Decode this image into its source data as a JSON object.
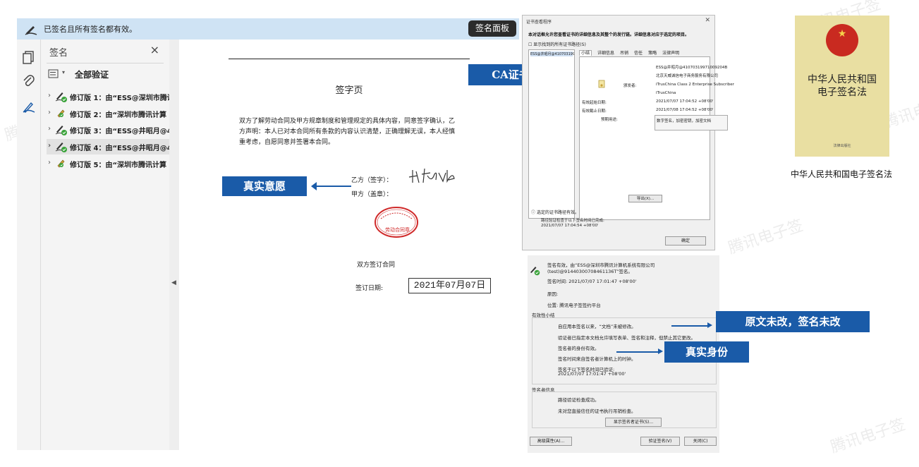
{
  "watermark": "腾讯电子签",
  "sig_bar": {
    "message": "已签名且所有签名都有效。",
    "panel_button": "签名面板"
  },
  "sig_panel": {
    "title": "签名",
    "close": "×",
    "verify_all": "全部验证",
    "revisions": [
      {
        "label": "修订版 1：由“ESS@深圳市腾讯",
        "icon": "valid-signature-icon"
      },
      {
        "label": "修订版 2：由“深圳市腾讯计算",
        "icon": "stamp-signature-icon"
      },
      {
        "label": "修订版 3：由“ESS@井昭月@4",
        "icon": "valid-signature-icon"
      },
      {
        "label": "修订版 4：由“ESS@井昭月@4",
        "icon": "valid-signature-icon",
        "selected": true
      },
      {
        "label": "修订版 5：由“深圳市腾讯计算",
        "icon": "stamp-signature-icon"
      }
    ]
  },
  "document": {
    "title": "签字页",
    "paragraph": "双方了解劳动合同及甲方规章制度和管理规定的具体内容，同意签字确认，乙方声明：本人已对本合同所有条款的内容认识清楚，正确理解无误，本人经慎重考虑，自愿同意并签署本合同。",
    "party_b": "乙方（签字）：",
    "party_a": "甲方（盖章）：",
    "seal_text": "劳动合同章",
    "signed_by_both": "双方签订合同",
    "sign_date_label": "签订日期:",
    "sign_date": "2021年07月07日"
  },
  "callouts": {
    "intent": "真实意愿",
    "ca_cert": "CA证书",
    "unchanged": "原文未改，签名未改",
    "identity": "真实身份"
  },
  "cert_viewer": {
    "title": "证书查看程序",
    "description": "本对话框允许您查看证书的详细信息及其整个的发行链。详细信息对应于选定的项目。",
    "show_all_paths": "显示找到的所有证书路径(S)",
    "list_item": "ESS@井昭月@41070319971002...",
    "tabs": [
      "小结",
      "详细信息",
      "吊销",
      "信任",
      "策略",
      "法律声明"
    ],
    "subject_lines": [
      "ESS@井昭月@41070319971009204B",
      "北京天威诚信电子商务服务有限公司"
    ],
    "issuer_label": "颁发者:",
    "issuer_lines": [
      "iTrusChina Class 2 Enterprise Subscriber",
      "iTrusChina"
    ],
    "valid_from_label": "有效起始日期:",
    "valid_from": "2021/07/07 17:04:52 +08'00'",
    "valid_to_label": "有效截止日期:",
    "valid_to": "2021/07/08 17:04:52 +08'00'",
    "usage_label": "预期用途:",
    "usage": "数字签名，加密密钥，加密文档",
    "export_button": "导出(X)...",
    "path_valid": "选定的证书路径有效。",
    "path_check": "路径验证检查于以下签名时间已完成:",
    "path_check_time": "2021/07/07 17:04:54 +08'00'",
    "ok_button": "确定"
  },
  "sig_properties": {
    "header_line1": "签名有效，由“ESS@深圳市腾讯计算机系统有限公司",
    "header_line2": "(test)@91440300708461136T”签名。",
    "sign_time": "签名时间:  2021/07/07 17:01:47 +08'00'",
    "reason": "原因:",
    "location": "位置:  腾讯电子签签约平台",
    "validity_title": "有效性小结",
    "validity_lines": [
      "自应用本签名以来，“文档”未被修改。",
      "验证者已指定本文档允许填写表单、签名和注释，但禁止其它更改。",
      "签名者的身份有效。",
      "签名时间来自签名者计算机上的时钟。",
      "签名于以下签名时间已验证:",
      "2021/07/07 17:01:47 +08'00'"
    ],
    "signer_title": "签名者信息",
    "signer_lines": [
      "路径验证检查成功。",
      "未对您直接信任的证书执行吊销检查。"
    ],
    "show_cert_button": "显示签名者证书(S)...",
    "advanced_button": "高级属性(A)...",
    "verify_button": "验证签名(V)",
    "close_button": "关闭(C)"
  },
  "law_book": {
    "title_line1": "中华人民共和国",
    "title_line2": "电子签名法",
    "publisher": "法律出版社",
    "caption": "中华人民共和国电子签名法"
  },
  "colors": {
    "callout_blue": "#1a5ba8",
    "sig_bar_bg": "#cfe3f4",
    "valid_green": "#3aa33a",
    "seal_red": "#d02a2a"
  }
}
